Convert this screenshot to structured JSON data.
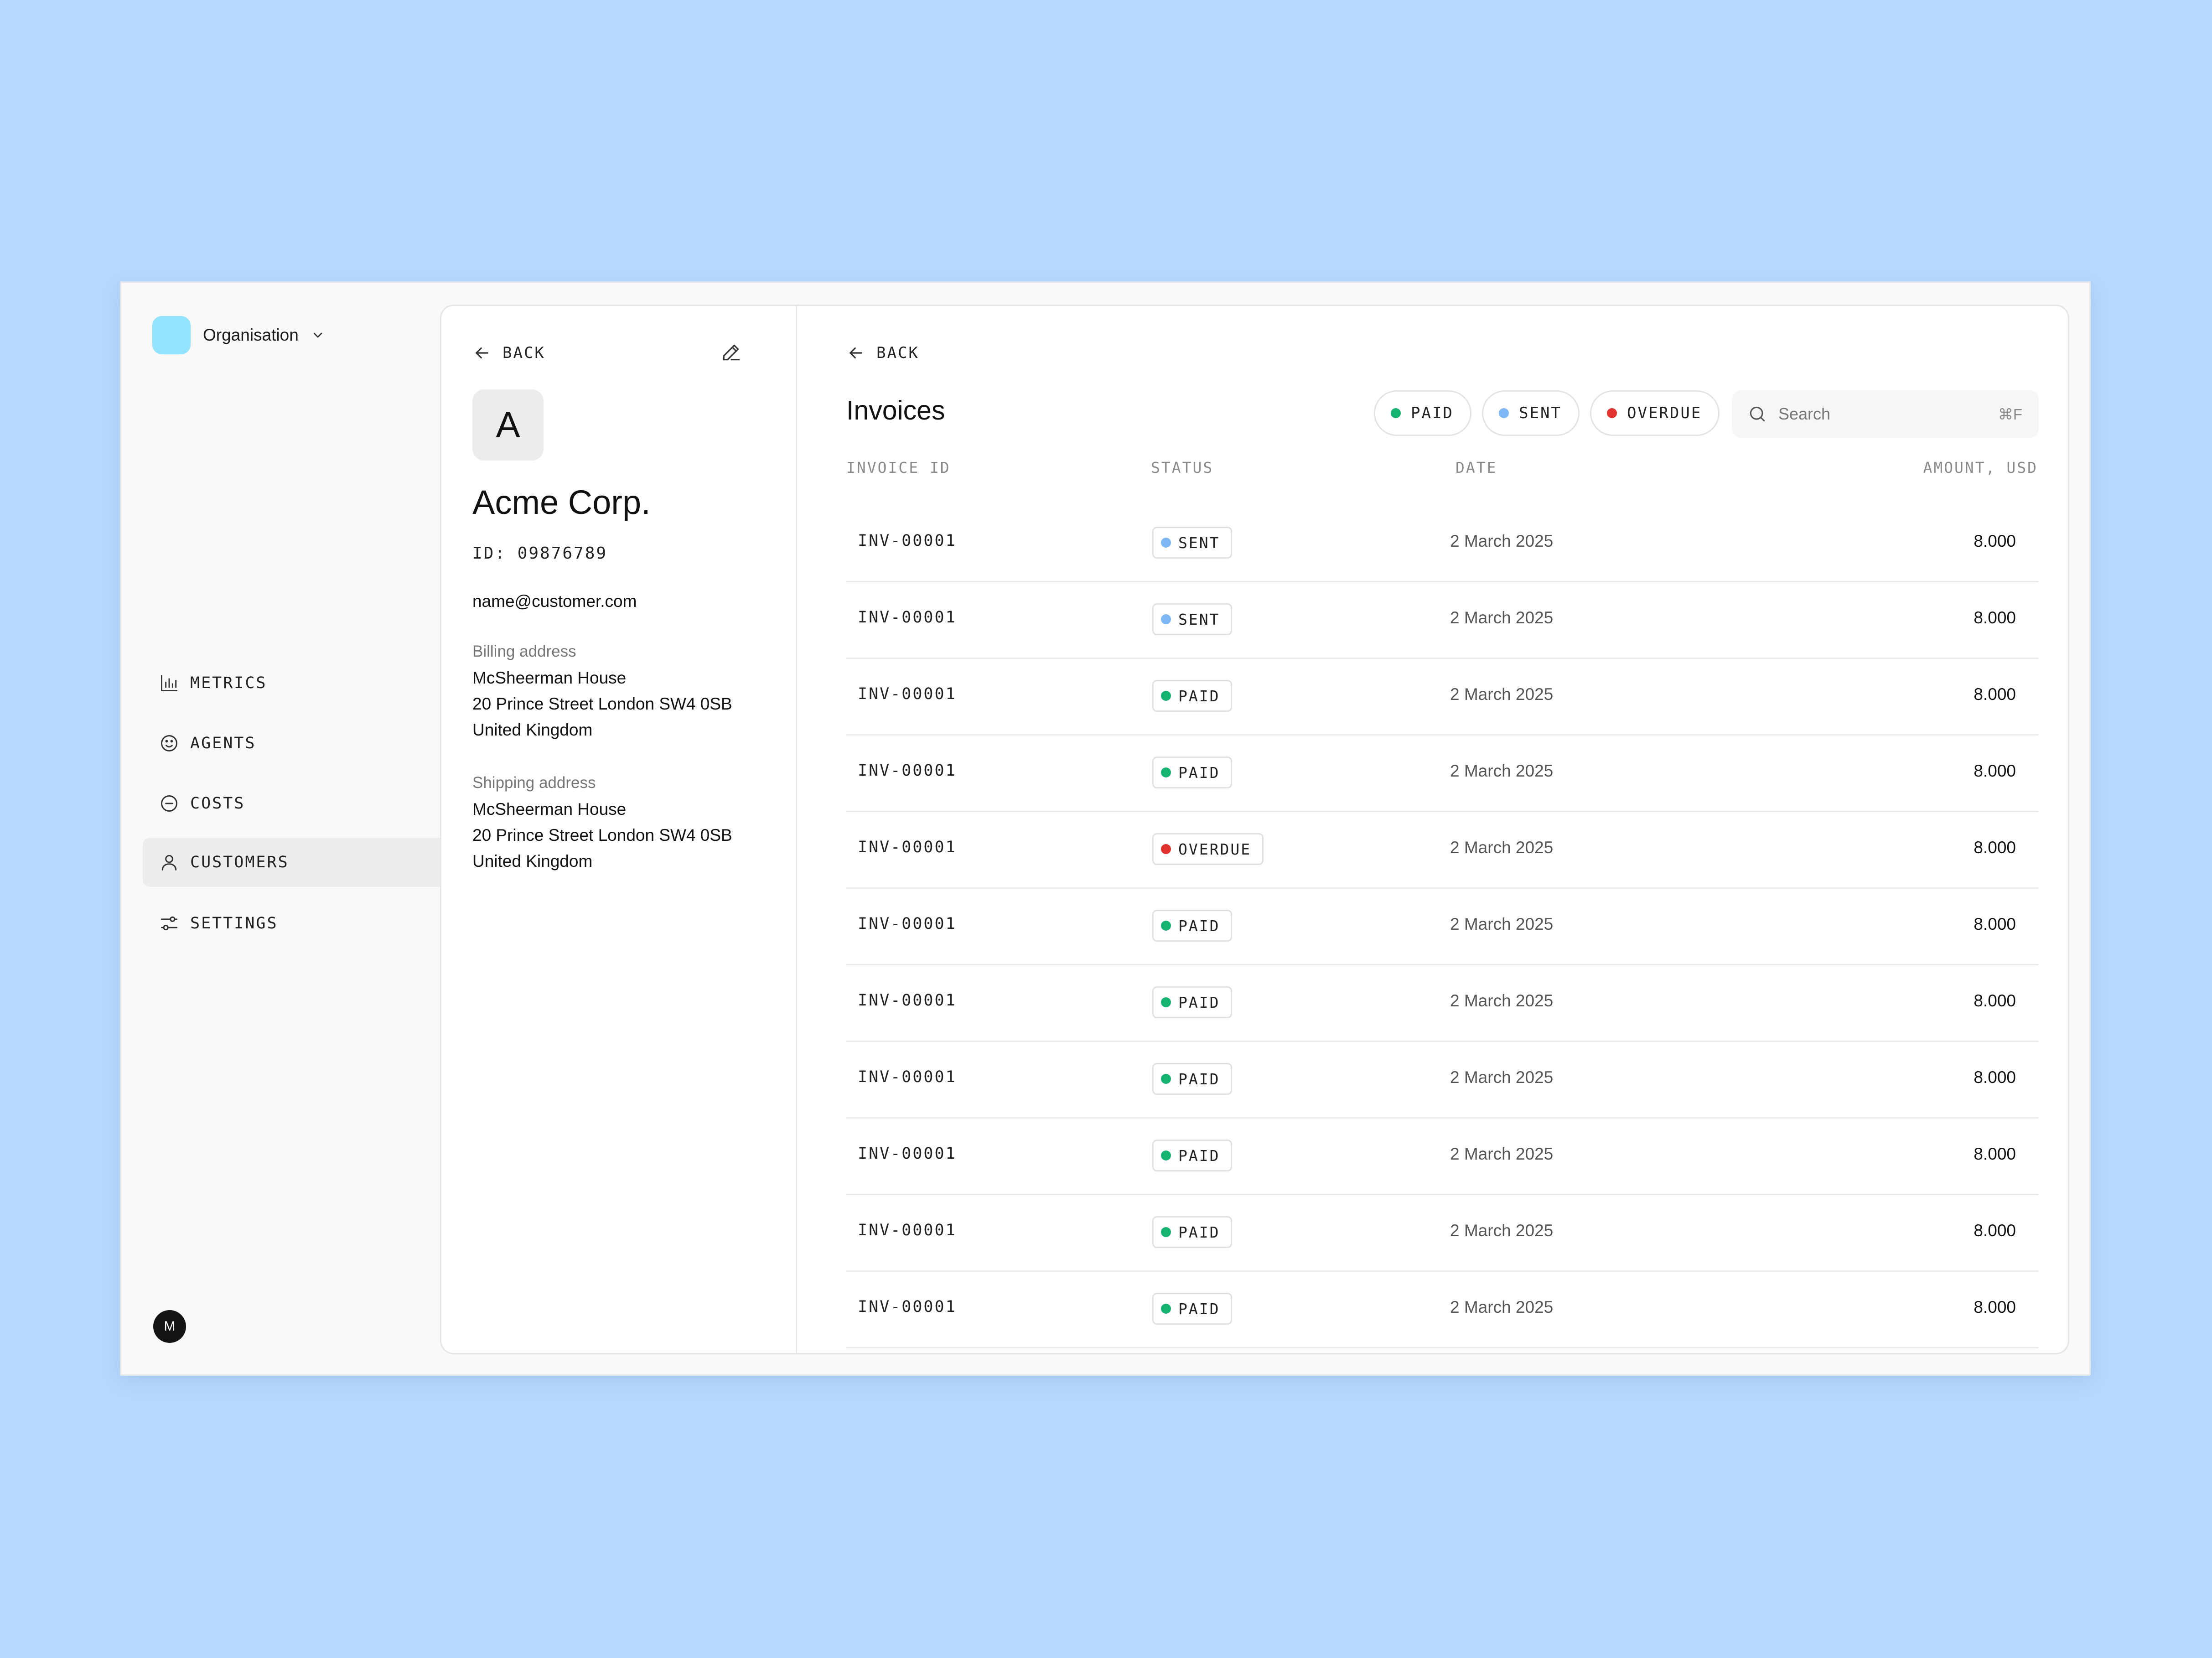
{
  "colors": {
    "paid": "#16b472",
    "sent": "#7db8f4",
    "overdue": "#e0322f",
    "org_logo": "#93e3fd"
  },
  "sidebar": {
    "org_name": "Organisation",
    "items": [
      {
        "label": "METRICS",
        "icon": "bar-chart-icon"
      },
      {
        "label": "AGENTS",
        "icon": "smile-icon"
      },
      {
        "label": "COSTS",
        "icon": "minus-circle-icon"
      },
      {
        "label": "CUSTOMERS",
        "icon": "user-icon",
        "active": true
      },
      {
        "label": "SETTINGS",
        "icon": "sliders-icon"
      }
    ],
    "user_initial": "M"
  },
  "customer": {
    "back_label": "BACK",
    "avatar_initial": "A",
    "name": "Acme Corp.",
    "id": "ID: 09876789",
    "email": "name@customer.com",
    "billing_label": "Billing address",
    "billing": [
      "McSheerman House",
      "20 Prince Street London SW4 0SB",
      "United Kingdom"
    ],
    "shipping_label": "Shipping address",
    "shipping": [
      "McSheerman House",
      "20 Prince Street London SW4 0SB",
      "United Kingdom"
    ]
  },
  "invoices": {
    "back_label": "BACK",
    "title": "Invoices",
    "filters": [
      {
        "label": "PAID",
        "status": "paid"
      },
      {
        "label": "SENT",
        "status": "sent"
      },
      {
        "label": "OVERDUE",
        "status": "overdue"
      }
    ],
    "search": {
      "placeholder": "Search",
      "shortcut": "⌘F"
    },
    "columns": {
      "id": "INVOICE ID",
      "status": "STATUS",
      "date": "DATE",
      "amount": "AMOUNT, USD"
    },
    "rows": [
      {
        "id": "INV-00001",
        "status": "SENT",
        "date": "2 March 2025",
        "amount": "8.000"
      },
      {
        "id": "INV-00001",
        "status": "SENT",
        "date": "2 March 2025",
        "amount": "8.000"
      },
      {
        "id": "INV-00001",
        "status": "PAID",
        "date": "2 March 2025",
        "amount": "8.000"
      },
      {
        "id": "INV-00001",
        "status": "PAID",
        "date": "2 March 2025",
        "amount": "8.000"
      },
      {
        "id": "INV-00001",
        "status": "OVERDUE",
        "date": "2 March 2025",
        "amount": "8.000"
      },
      {
        "id": "INV-00001",
        "status": "PAID",
        "date": "2 March 2025",
        "amount": "8.000"
      },
      {
        "id": "INV-00001",
        "status": "PAID",
        "date": "2 March 2025",
        "amount": "8.000"
      },
      {
        "id": "INV-00001",
        "status": "PAID",
        "date": "2 March 2025",
        "amount": "8.000"
      },
      {
        "id": "INV-00001",
        "status": "PAID",
        "date": "2 March 2025",
        "amount": "8.000"
      },
      {
        "id": "INV-00001",
        "status": "PAID",
        "date": "2 March 2025",
        "amount": "8.000"
      },
      {
        "id": "INV-00001",
        "status": "PAID",
        "date": "2 March 2025",
        "amount": "8.000"
      }
    ]
  }
}
